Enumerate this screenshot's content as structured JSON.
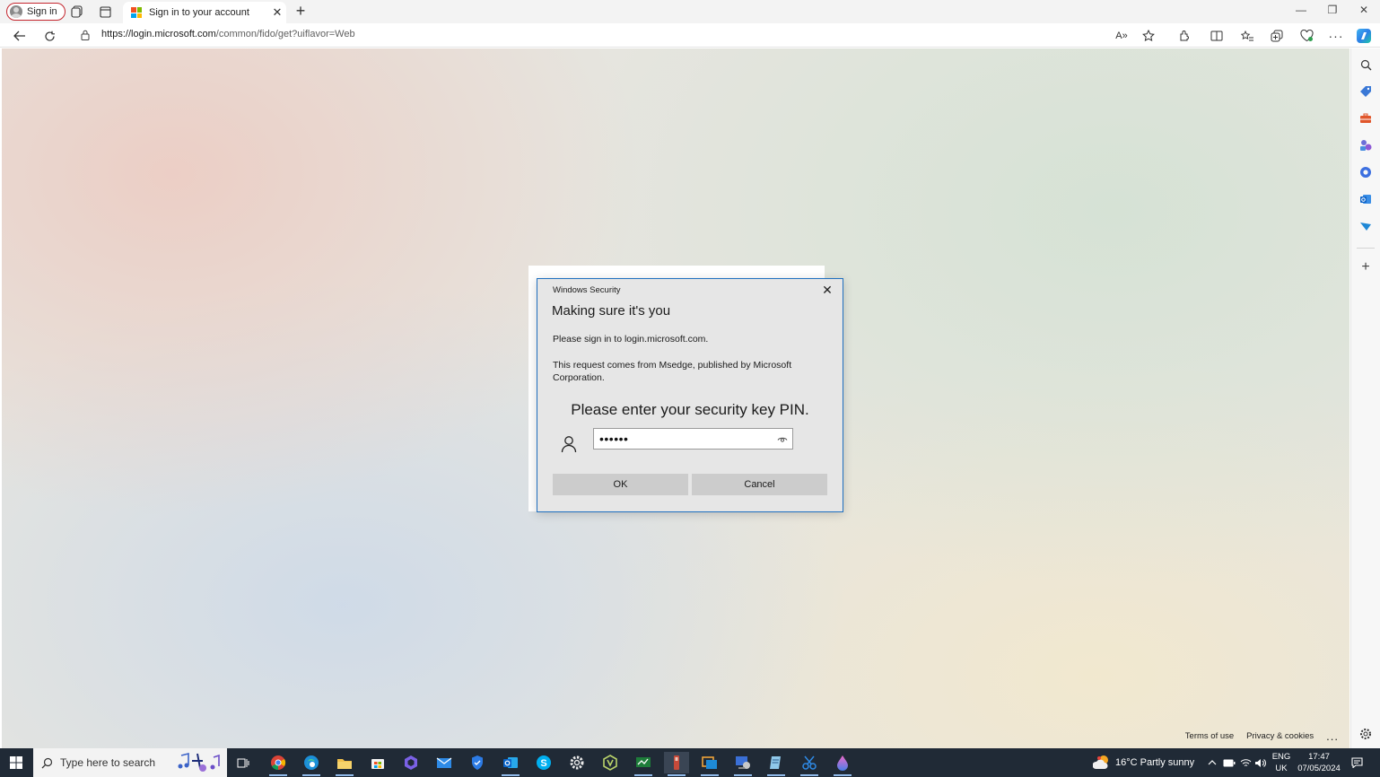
{
  "browser": {
    "profile_label": "Sign in",
    "tab_title": "Sign in to your account",
    "tab_close": "✕",
    "new_tab": "+",
    "url_host": "https://login.microsoft.com",
    "url_path": "/common/fido/get?uiflavor=Web",
    "read_aloud": "A»"
  },
  "window_controls": {
    "minimize": "—",
    "restore": "❐",
    "close": "✕"
  },
  "dialog": {
    "caption": "Windows Security",
    "close": "✕",
    "title": "Making sure it's you",
    "line1": "Please sign in to login.microsoft.com.",
    "line2": "This request comes from Msedge, published by Microsoft Corporation.",
    "prompt": "Please enter your security key PIN.",
    "pin_value": "••••••",
    "ok_label": "OK",
    "cancel_label": "Cancel"
  },
  "page_footer": {
    "terms": "Terms of use",
    "privacy": "Privacy & cookies",
    "more": "..."
  },
  "taskbar": {
    "search_placeholder": "Type here to search",
    "weather": "16°C  Partly sunny",
    "lang_line1": "ENG",
    "lang_line2": "UK",
    "time": "17:47",
    "date": "07/05/2024"
  },
  "colors": {
    "dialog_border": "#1f6fbf",
    "taskbar": "#202a36",
    "profile_ring": "#c4262e",
    "ms_red": "#f25022",
    "ms_green": "#7fba00",
    "ms_blue": "#00a4ef",
    "ms_yellow": "#ffb900"
  }
}
